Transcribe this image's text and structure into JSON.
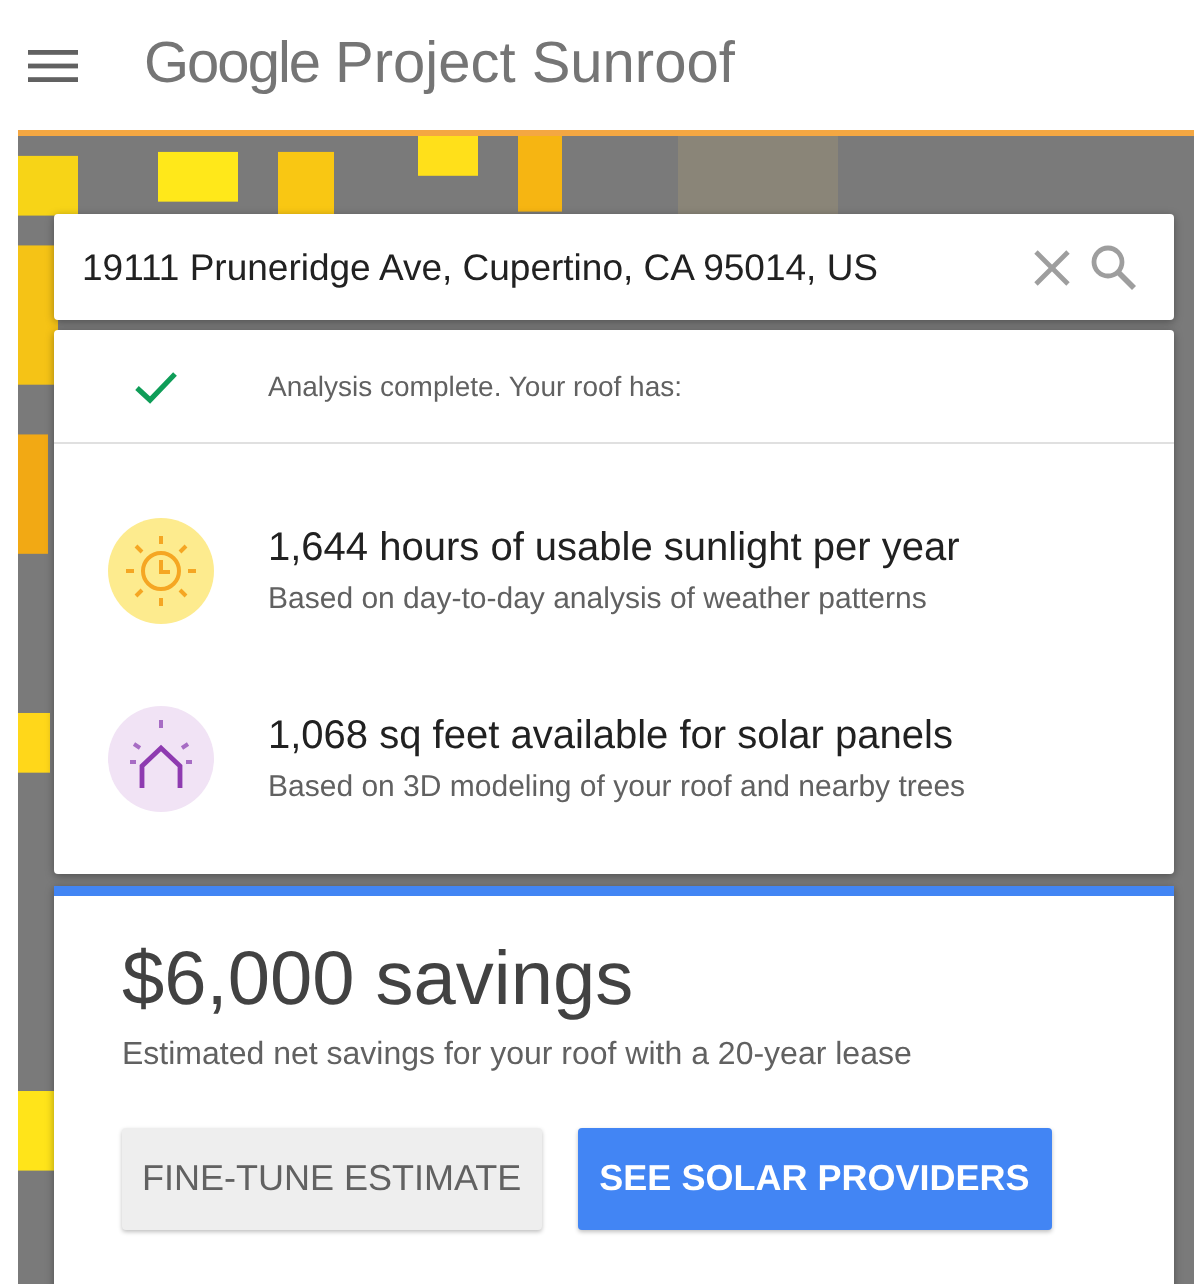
{
  "header": {
    "logo": "Google",
    "title": "Project Sunroof"
  },
  "search": {
    "value": "19111 Pruneridge Ave, Cupertino, CA 95014, US"
  },
  "analysis": {
    "complete": true,
    "status": "Analysis complete. Your roof has:",
    "facts": [
      {
        "kind": "sunlight",
        "title": "1,644 hours of usable sunlight per year",
        "detail": "Based on day-to-day analysis of weather patterns"
      },
      {
        "kind": "area",
        "title": "1,068 sq feet available for solar panels",
        "detail": "Based on 3D modeling of your roof and nearby trees"
      }
    ]
  },
  "savings": {
    "amount": "$6,000 savings",
    "detail": "Estimated net savings for your roof with a 20-year lease",
    "buttons": [
      {
        "label": "FINE-TUNE ESTIMATE",
        "kind": "secondary"
      },
      {
        "label": "SEE SOLAR PROVIDERS",
        "kind": "primary"
      }
    ]
  }
}
